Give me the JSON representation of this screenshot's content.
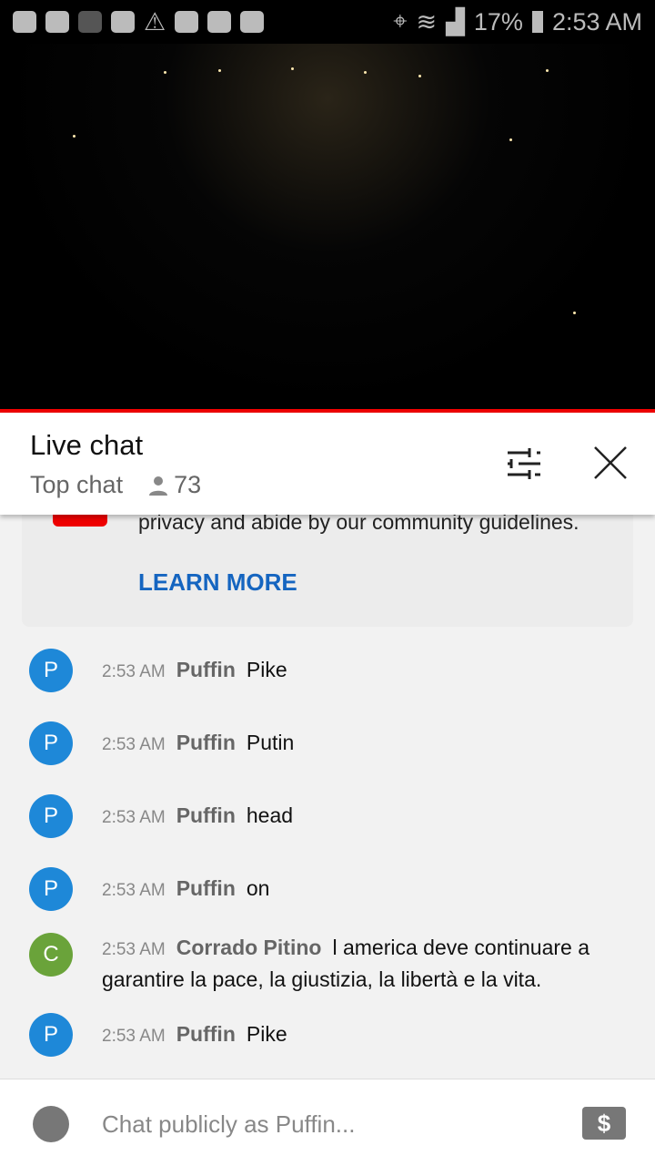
{
  "status": {
    "battery": "17%",
    "time": "2:53 AM"
  },
  "chat": {
    "title": "Live chat",
    "mode": "Top chat",
    "viewers": "73"
  },
  "banner": {
    "text": "privacy and abide by our community guidelines.",
    "learn_more": "LEARN MORE"
  },
  "messages": [
    {
      "initial": "P",
      "color": "#1e88d8",
      "time": "2:53 AM",
      "author": "Puffin",
      "text": "Pike"
    },
    {
      "initial": "P",
      "color": "#1e88d8",
      "time": "2:53 AM",
      "author": "Puffin",
      "text": "Putin"
    },
    {
      "initial": "P",
      "color": "#1e88d8",
      "time": "2:53 AM",
      "author": "Puffin",
      "text": "head"
    },
    {
      "initial": "P",
      "color": "#1e88d8",
      "time": "2:53 AM",
      "author": "Puffin",
      "text": "on"
    },
    {
      "initial": "C",
      "color": "#6aa33a",
      "time": "2:53 AM",
      "author": "Corrado Pitino",
      "text": "l america deve continuare a garantire la pace, la giustizia, la libertà e la vita."
    },
    {
      "initial": "P",
      "color": "#1e88d8",
      "time": "2:53 AM",
      "author": "Puffin",
      "text": "Pike"
    }
  ],
  "input": {
    "placeholder": "Chat publicly as Puffin...",
    "super_chat_symbol": "$"
  }
}
